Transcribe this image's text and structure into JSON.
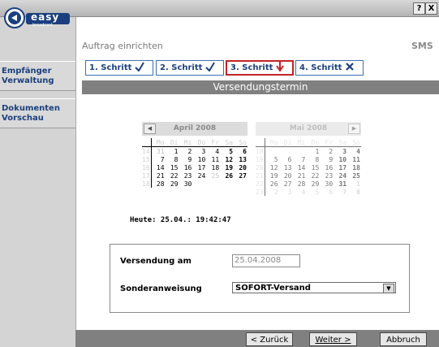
{
  "window": {
    "help_btn": "?",
    "close_btn": "X"
  },
  "sidebar": {
    "logo_text": "easy",
    "logo_sub": "broadcast",
    "items": [
      {
        "line1": "Empfänger",
        "line2": "Verwaltung"
      },
      {
        "line1": "Dokumenten",
        "line2": "Vorschau"
      }
    ]
  },
  "header": {
    "title": "Auftrag einrichten",
    "product": "SMS"
  },
  "steps": [
    {
      "label": "1. Schritt",
      "icon": "check-icon"
    },
    {
      "label": "2. Schritt",
      "icon": "check-icon"
    },
    {
      "label": "3. Schritt",
      "icon": "arrow-down-icon"
    },
    {
      "label": "4. Schritt",
      "icon": "cross-icon"
    }
  ],
  "section_title": "Versendungstermin",
  "calendars": [
    {
      "month": "April 2008",
      "nav": "prev",
      "days": [
        "Mo",
        "Di",
        "Mi",
        "Do",
        "Fr",
        "Sa",
        "So"
      ],
      "weeks": [
        {
          "wk": "14",
          "d": [
            "31",
            "1",
            "2",
            "3",
            "4",
            "5",
            "6"
          ]
        },
        {
          "wk": "15",
          "d": [
            "7",
            "8",
            "9",
            "10",
            "11",
            "12",
            "13"
          ]
        },
        {
          "wk": "16",
          "d": [
            "14",
            "15",
            "16",
            "17",
            "18",
            "19",
            "20"
          ]
        },
        {
          "wk": "17",
          "d": [
            "21",
            "22",
            "23",
            "24",
            "25",
            "26",
            "27"
          ]
        },
        {
          "wk": "18",
          "d": [
            "28",
            "29",
            "30",
            "",
            "",
            "",
            ""
          ]
        }
      ]
    },
    {
      "month": "Mai 2008",
      "nav": "next",
      "days": [
        "Mo",
        "Di",
        "Mi",
        "Do",
        "Fr",
        "Sa",
        "So"
      ],
      "weeks": [
        {
          "wk": "18",
          "d": [
            "",
            "",
            "",
            "1",
            "2",
            "3",
            "4"
          ]
        },
        {
          "wk": "19",
          "d": [
            "5",
            "6",
            "7",
            "8",
            "9",
            "10",
            "11"
          ]
        },
        {
          "wk": "20",
          "d": [
            "12",
            "13",
            "14",
            "15",
            "16",
            "17",
            "18"
          ]
        },
        {
          "wk": "21",
          "d": [
            "19",
            "20",
            "21",
            "22",
            "23",
            "24",
            "25"
          ]
        },
        {
          "wk": "22",
          "d": [
            "26",
            "27",
            "28",
            "29",
            "30",
            "31",
            "1"
          ]
        },
        {
          "wk": "23",
          "d": [
            "2",
            "3",
            "4",
            "5",
            "6",
            "7",
            "8"
          ]
        }
      ]
    }
  ],
  "today": "Heute: 25.04.: 19:42:47",
  "form": {
    "send_label": "Versendung am",
    "send_value": "25.04.2008",
    "instr_label": "Sonderanweisung",
    "instr_value": "SOFORT-Versand"
  },
  "footer": {
    "back": "< Zurück",
    "next": "Weiter >",
    "cancel": "Abbruch"
  }
}
